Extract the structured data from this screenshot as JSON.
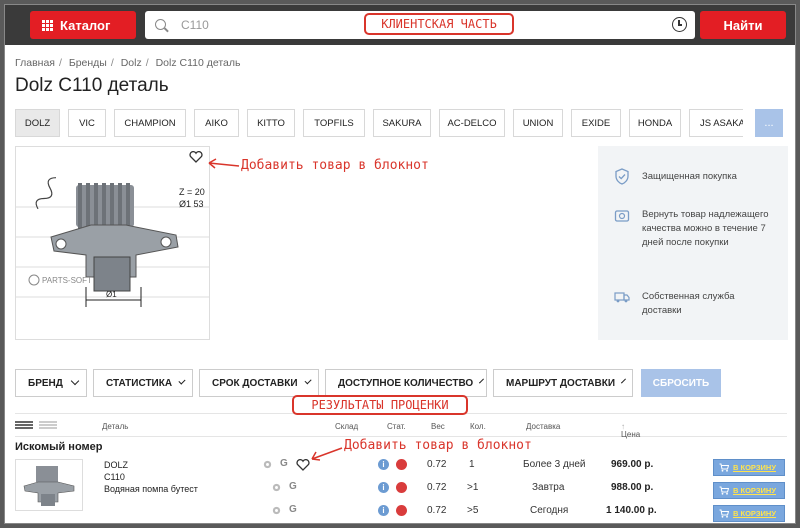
{
  "header": {
    "catalog_label": "Каталог",
    "search_value": "C110",
    "find_label": "Найти"
  },
  "annotations": {
    "client_part": "КЛИЕНТСКАЯ ЧАСТЬ",
    "add_to_notebook_top": "Добавить товар в блокнот",
    "results": "РЕЗУЛЬТАТЫ ПРОЦЕНКИ",
    "add_to_notebook_row": "Добавить товар в блокнот"
  },
  "breadcrumb": [
    "Главная",
    "Бренды",
    "Dolz",
    "Dolz C110 деталь"
  ],
  "page_title": "Dolz C110 деталь",
  "brands": [
    "DOLZ",
    "VIC",
    "CHAMPION",
    "AIKO",
    "KITTO",
    "TOPFILS",
    "SAKURA",
    "AC-DELCO",
    "UNION",
    "EXIDE",
    "HONDA",
    "JS ASAKASHI"
  ],
  "brands_more": "...",
  "product_image": {
    "z_label": "Z = 20",
    "d_label": "Ø1 53",
    "d1_label": "Ø1",
    "watermark": "PARTS-SOFT"
  },
  "info": [
    {
      "icon": "shield-icon",
      "text": "Защищенная покупка"
    },
    {
      "icon": "return-icon",
      "text": "Вернуть товар надлежащего качества можно в течение 7 дней после покупки"
    },
    {
      "icon": "truck-icon",
      "text": "Собственная служба доставки"
    }
  ],
  "filters": [
    "БРЕНД",
    "СТАТИСТИКА",
    "СРОК ДОСТАВКИ",
    "ДОСТУПНОЕ КОЛИЧЕСТВО",
    "МАРШРУТ ДОСТАВКИ"
  ],
  "reset_label": "СБРОСИТЬ",
  "table": {
    "headers": {
      "part": "Деталь",
      "warehouse": "Склад",
      "stat": "Стат.",
      "weight": "Вес",
      "qty": "Кол.",
      "delivery": "Доставка",
      "price": "Цена"
    },
    "section_label": "Искомый номер",
    "part": {
      "brand": "DOLZ",
      "number": "C110",
      "name": "Водяная помпа бутест"
    },
    "rows": [
      {
        "weight": "0.72",
        "qty": "1",
        "delivery": "Более 3 дней",
        "price": "969.00 р.",
        "cart_label": "В КОРЗИНУ"
      },
      {
        "weight": "0.72",
        "qty": ">1",
        "delivery": "Завтра",
        "price": "988.00 р.",
        "cart_label": "В КОРЗИНУ"
      },
      {
        "weight": "0.72",
        "qty": ">5",
        "delivery": "Сегодня",
        "price": "1 140.00 р.",
        "cart_label": "В КОРЗИНУ"
      }
    ]
  },
  "colors": {
    "accent_red": "#e31e24",
    "header_dark": "#3a3a3a",
    "light_blue": "#a9c3e8",
    "annotation_red": "#d9352b",
    "cart_yellow": "#ffe34c"
  }
}
